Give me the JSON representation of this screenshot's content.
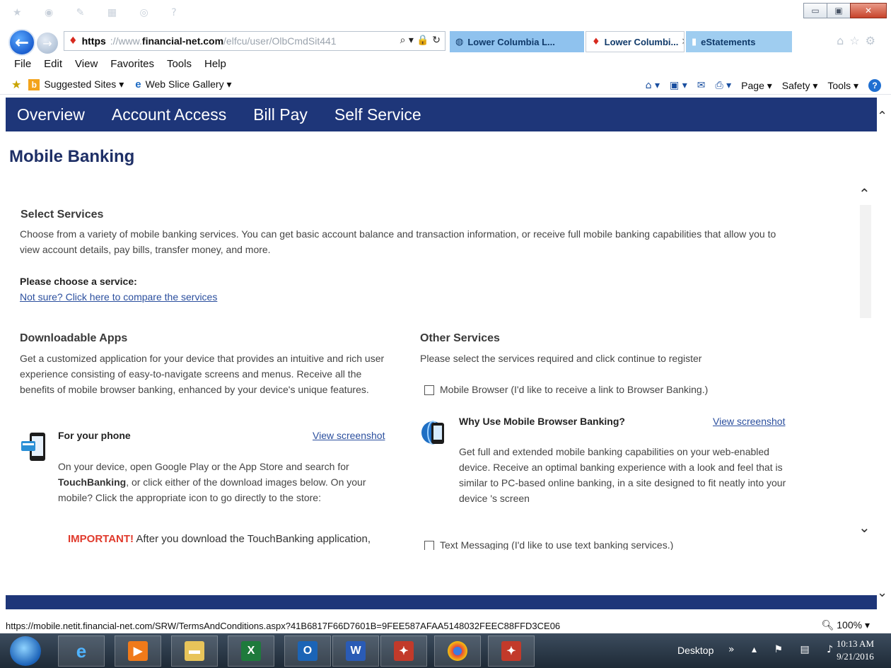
{
  "window": {
    "minimize": "▭",
    "restore": "▣",
    "close": "✕"
  },
  "address": {
    "scheme": "https",
    "faint": "://www.",
    "domain": "financial-net.com",
    "path": "/elfcu/user/OlbCmdSit441",
    "actions": "⌕ ▾ 🔒 ↻"
  },
  "tabs": [
    {
      "label": "Lower Columbia L...",
      "icon": "globe-icon"
    },
    {
      "label": "Lower Columbi...",
      "icon": "site-favicon",
      "close": "✕"
    },
    {
      "label": "eStatements",
      "icon": "blank-page-icon"
    }
  ],
  "menu": [
    "File",
    "Edit",
    "View",
    "Favorites",
    "Tools",
    "Help"
  ],
  "favorites": {
    "suggested": "Suggested Sites ▾",
    "webslice": "Web Slice Gallery ▾"
  },
  "command_bar": {
    "page": "Page ▾",
    "safety": "Safety ▾",
    "tools": "Tools ▾"
  },
  "site_nav": [
    "Overview",
    "Account Access",
    "Bill Pay",
    "Self Service"
  ],
  "page_title": "Mobile Banking",
  "select_services": {
    "title": "Select Services",
    "description": "Choose from a variety of mobile banking services. You can get basic account balance and transaction information, or receive full mobile banking capabilities that allow you to view account details, pay bills, transfer money, and more.",
    "prompt": "Please choose a service:",
    "compare_link": "Not sure? Click here to compare the services"
  },
  "downloadable_apps": {
    "title": "Downloadable Apps",
    "description": "Get a customized application for your device that provides an intuitive and rich user experience consisting of easy-to-navigate screens and menus. Receive all the benefits of mobile browser banking, enhanced by your device's unique features.",
    "phone_heading": "For your phone",
    "view_screenshot": "View screenshot",
    "instructions_1": "On your device, open Google Play or the App Store and search for",
    "touchbanking": "TouchBanking",
    "instructions_2": ", or click either of the download images below. On your mobile? Click the appropriate icon to go directly to the store:",
    "important_label": "IMPORTANT!",
    "important_text": " After you download the TouchBanking application,"
  },
  "other_services": {
    "title": "Other Services",
    "description": "Please select the services required and click continue to register",
    "mobile_browser_option": "Mobile Browser (I'd like to receive a link to Browser Banking.)",
    "why_heading": "Why Use Mobile Browser Banking?",
    "view_screenshot": "View screenshot",
    "why_text": "Get full and extended mobile banking capabilities on your web-enabled device. Receive an optimal banking experience with a look and feel that is similar to PC-based online banking, in a site designed to fit neatly into your device 's screen",
    "text_messaging_option": "Text Messaging (I'd like to use text banking services.)"
  },
  "status_url": "https://mobile.netit.financial-net.com/SRW/TermsAndConditions.aspx?41B6817F66D7601B=9FEE587AFAA5148032FEEC88FFD3CE06",
  "zoom": "100%",
  "taskbar": {
    "desktop": "Desktop",
    "time": "10:13 AM",
    "date": "9/21/2016"
  }
}
